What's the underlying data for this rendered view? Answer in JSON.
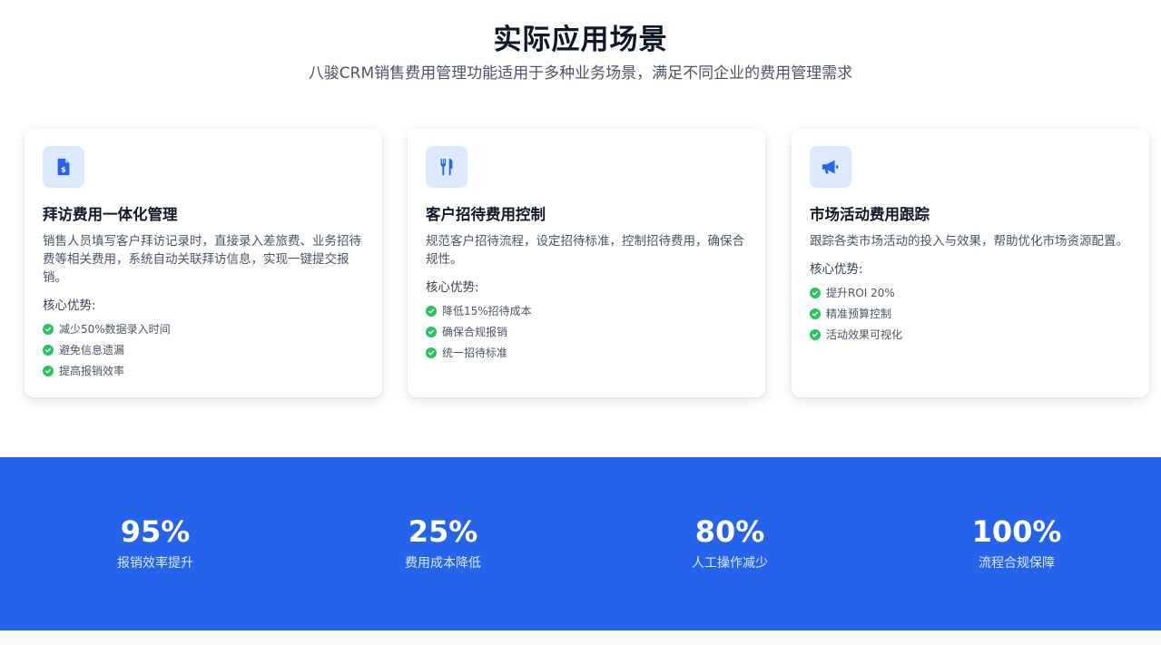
{
  "section": {
    "title": "实际应用场景",
    "subtitle": "八骏CRM销售费用管理功能适用于多种业务场景，满足不同企业的费用管理需求"
  },
  "colors": {
    "accent": "#2563eb",
    "icon_bg": "#dbeafe",
    "check": "#22c55e"
  },
  "cards": [
    {
      "icon": "invoice-dollar-icon",
      "title": "拜访费用一体化管理",
      "desc": "销售人员填写客户拜访记录时，直接录入差旅费、业务招待费等相关费用，系统自动关联拜访信息，实现一键提交报销。",
      "adv_label": "核心优势:",
      "advantages": [
        "减少50%数据录入时间",
        "避免信息遗漏",
        "提高报销效率"
      ]
    },
    {
      "icon": "utensils-icon",
      "title": "客户招待费用控制",
      "desc": "规范客户招待流程，设定招待标准，控制招待费用，确保合规性。",
      "adv_label": "核心优势:",
      "advantages": [
        "降低15%招待成本",
        "确保合规报销",
        "统一招待标准"
      ]
    },
    {
      "icon": "megaphone-icon",
      "title": "市场活动费用跟踪",
      "desc": "跟踪各类市场活动的投入与效果，帮助优化市场资源配置。",
      "adv_label": "核心优势:",
      "advantages": [
        "提升ROI 20%",
        "精准预算控制",
        "活动效果可视化"
      ]
    }
  ],
  "stats": [
    {
      "value": "95%",
      "label": "报销效率提升"
    },
    {
      "value": "25%",
      "label": "费用成本降低"
    },
    {
      "value": "80%",
      "label": "人工操作减少"
    },
    {
      "value": "100%",
      "label": "流程合规保障"
    }
  ]
}
